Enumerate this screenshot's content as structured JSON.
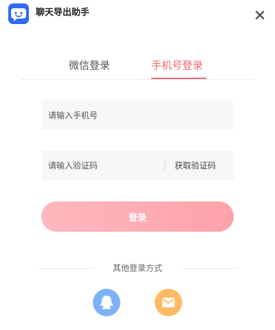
{
  "app": {
    "title": "聊天导出助手",
    "icon": "chat-bubble-icon",
    "accent_color": "#2f6af5"
  },
  "window": {
    "close_icon": "close-icon"
  },
  "tabs": [
    {
      "label": "微信登录",
      "active": false
    },
    {
      "label": "手机号登录",
      "active": true
    }
  ],
  "tab_active_color": "#ec6a6f",
  "form": {
    "phone_placeholder": "请输入手机号",
    "phone_value": "",
    "code_placeholder": "请输入验证码",
    "code_value": "",
    "get_code_label": "获取验证码",
    "login_label": "登录",
    "login_color": "#fda2aa"
  },
  "other_login": {
    "label": "其他登录方式",
    "methods": [
      {
        "icon": "qq-icon",
        "color": "#7eb2f7"
      },
      {
        "icon": "mail-icon",
        "color": "#ffba66"
      }
    ]
  }
}
